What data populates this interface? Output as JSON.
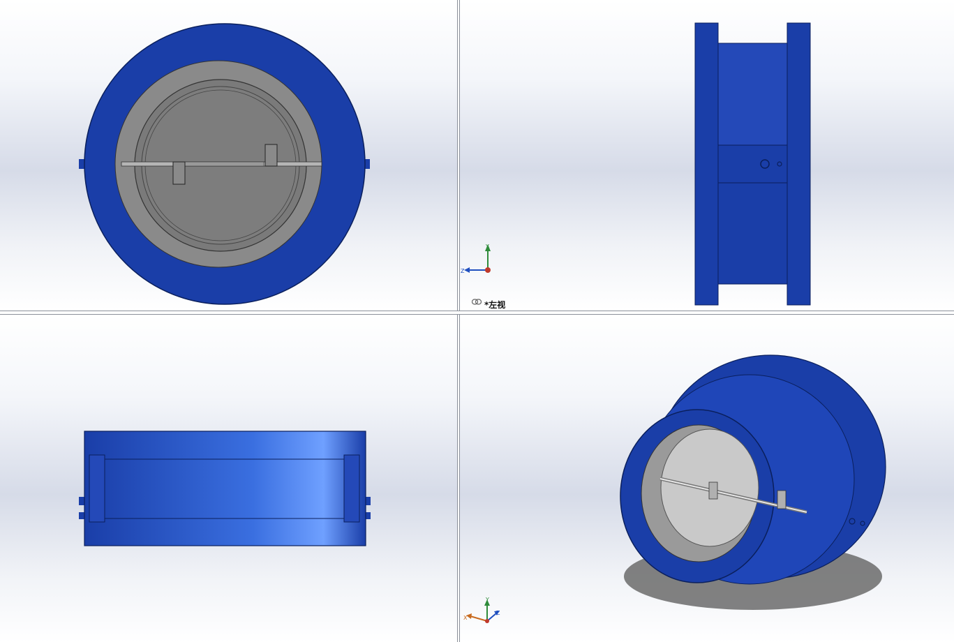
{
  "viewports": {
    "left_view": {
      "label": "*左视",
      "icon": "chain-link-icon"
    }
  },
  "triads": {
    "left_view": {
      "axes": [
        "Y",
        "Z"
      ]
    },
    "isometric": {
      "axes": [
        "Y",
        "X",
        "Z"
      ]
    }
  },
  "colors": {
    "valve_body": "#1a3ea8",
    "valve_body_dark": "#0f2a7a",
    "disc_gray": "#7d7d7d",
    "axis_x": "#c0392b",
    "axis_y": "#2e8b3a",
    "axis_z": "#1f4fbf"
  }
}
